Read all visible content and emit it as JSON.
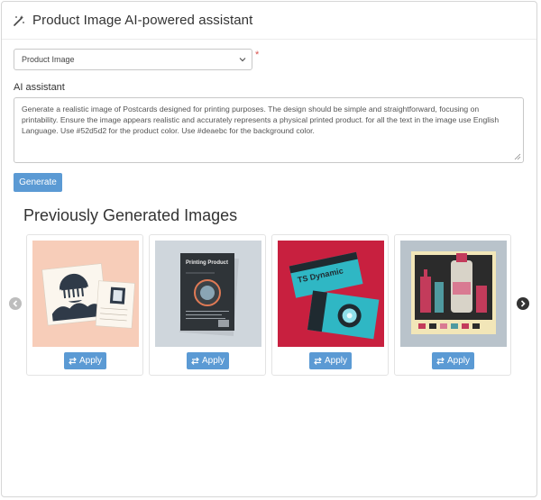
{
  "header": {
    "title": "Product Image AI-powered assistant",
    "icon": "magic-wand-icon"
  },
  "select": {
    "value": "Product Image",
    "required_mark": "*"
  },
  "assistant": {
    "label": "AI assistant",
    "prompt": "Generate a realistic image of Postcards designed for printing purposes. The design should be simple and straightforward, focusing on printability. Ensure the image appears realistic and accurately represents a physical printed product. for all the text in the image use English Language.  Use #52d5d2 for the product color. Use #deaebc for the background color."
  },
  "generate_label": "Generate",
  "gallery": {
    "title": "Previously Generated Images",
    "cards": [
      {
        "apply_label": "Apply"
      },
      {
        "apply_label": "Apply",
        "thumb_text": "Printing Product"
      },
      {
        "apply_label": "Apply",
        "thumb_text": "TS Dynamic"
      },
      {
        "apply_label": "Apply"
      }
    ]
  },
  "colors": {
    "accent": "#5b9ad4",
    "required": "#d9534f"
  }
}
